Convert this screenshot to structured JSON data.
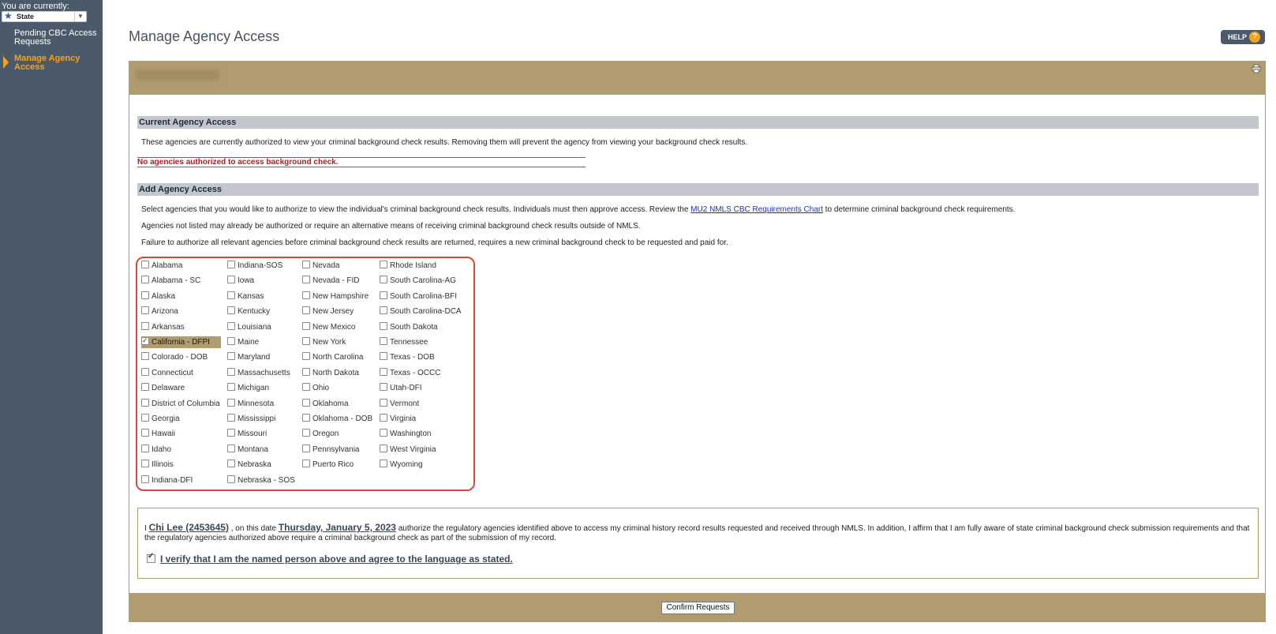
{
  "sidebar": {
    "you_label": "You are currently:",
    "state_value": "State",
    "items": [
      {
        "label": "Pending CBC Access Requests"
      },
      {
        "label": "Manage Agency Access"
      }
    ]
  },
  "page": {
    "title": "Manage Agency Access",
    "help_label": "HELP",
    "help_q": "?"
  },
  "current": {
    "header": "Current Agency Access",
    "description": "These agencies are currently authorized to view your criminal background check results. Removing them will prevent the agency from viewing your background check results.",
    "error": "No agencies authorized to access background check."
  },
  "add": {
    "header": "Add Agency Access",
    "line1_pre": "Select agencies that you would like to authorize to view the individual's criminal background check results. Individuals must then approve access. Review the ",
    "line1_link": "MU2 NMLS CBC Requirements Chart",
    "line1_post": " to determine criminal background check requirements.",
    "line2": "Agencies not listed may already be authorized or require an alternative means of receiving criminal background check results outside of NMLS.",
    "line3": "Failure to authorize all relevant agencies before criminal background check results are returned, requires a new criminal background check to be requested and paid for."
  },
  "agencies": {
    "col1": [
      "Alabama",
      "Alabama - SC",
      "Alaska",
      "Arizona",
      "Arkansas",
      "California - DFPI",
      "Colorado - DOB",
      "Connecticut",
      "Delaware",
      "District of Columbia",
      "Georgia",
      "Hawaii",
      "Idaho",
      "Illinois",
      "Indiana-DFI"
    ],
    "col2": [
      "Indiana-SOS",
      "Iowa",
      "Kansas",
      "Kentucky",
      "Louisiana",
      "Maine",
      "Maryland",
      "Massachusetts",
      "Michigan",
      "Minnesota",
      "Mississippi",
      "Missouri",
      "Montana",
      "Nebraska",
      "Nebraska - SOS"
    ],
    "col3": [
      "Nevada",
      "Nevada - FID",
      "New Hampshire",
      "New Jersey",
      "New Mexico",
      "New York",
      "North Carolina",
      "North Dakota",
      "Ohio",
      "Oklahoma",
      "Oklahoma - DOB",
      "Oregon",
      "Pennsylvania",
      "Puerto Rico"
    ],
    "col4": [
      "Rhode Island",
      "South Carolina-AG",
      "South Carolina-BFI",
      "South Carolina-DCA",
      "South Dakota",
      "Tennessee",
      "Texas - DOB",
      "Texas - OCCC",
      "Utah-DFI",
      "Vermont",
      "Virginia",
      "Washington",
      "West Virginia",
      "Wyoming"
    ],
    "checked": [
      "California - DFPI"
    ]
  },
  "attestation": {
    "i": "I ",
    "name": "Chi Lee (2453645)",
    "date_pre": " , on this date ",
    "date": "Thursday, January 5, 2023",
    "text": " authorize the regulatory agencies identified above to access my criminal history record results requested and received through NMLS. In addition, I affirm that I am fully aware of state criminal background check submission requirements and that the regulatory agencies authorized above require a criminal background check as part of the submission of my record.",
    "verify_label": "I verify that I am the named person above and agree to the language as stated."
  },
  "footer": {
    "confirm_label": "Confirm Requests"
  },
  "colors": {
    "sidebar": "#4b5a6a",
    "accent": "#f7a11a",
    "tan": "#b19c70",
    "error": "#c4151c"
  }
}
